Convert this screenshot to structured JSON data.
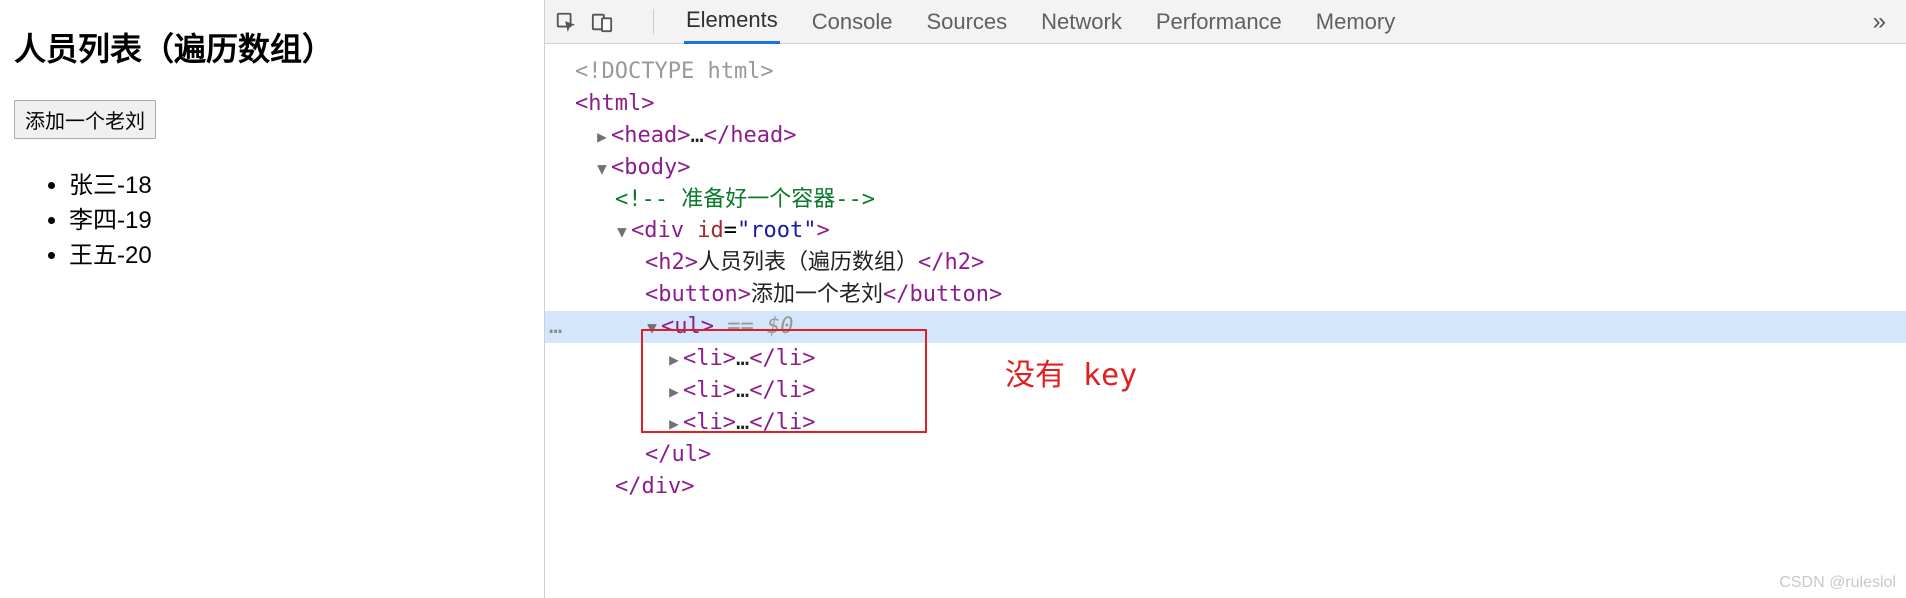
{
  "page": {
    "title": "人员列表（遍历数组）",
    "button_label": "添加一个老刘",
    "people": [
      "张三-18",
      "李四-19",
      "王五-20"
    ]
  },
  "devtools": {
    "tabs": {
      "elements": "Elements",
      "console": "Console",
      "sources": "Sources",
      "network": "Network",
      "performance": "Performance",
      "memory": "Memory"
    },
    "overflow": "»"
  },
  "dom": {
    "doctype": "<!DOCTYPE html>",
    "html_open": "<html>",
    "head": {
      "open": "<head>",
      "ell": "…",
      "close": "</head>"
    },
    "body_open": "<body>",
    "comment": "<!-- 准备好一个容器-->",
    "div": {
      "open_pre": "<div ",
      "attr_name": "id",
      "attr_val": "\"root\"",
      "open_post": ">"
    },
    "h2": {
      "open": "<h2>",
      "text": "人员列表（遍历数组）",
      "close": "</h2>"
    },
    "button": {
      "open": "<button>",
      "text": "添加一个老刘",
      "close": "</button>"
    },
    "ul": {
      "open": "<ul>",
      "sel": " == $0",
      "close": "</ul>"
    },
    "li": {
      "open": "<li>",
      "ell": "…",
      "close": "</li>"
    },
    "div_close": "</div>",
    "gutter_dots": "…"
  },
  "annotation": "没有 key",
  "watermark": "CSDN @ruleslol"
}
